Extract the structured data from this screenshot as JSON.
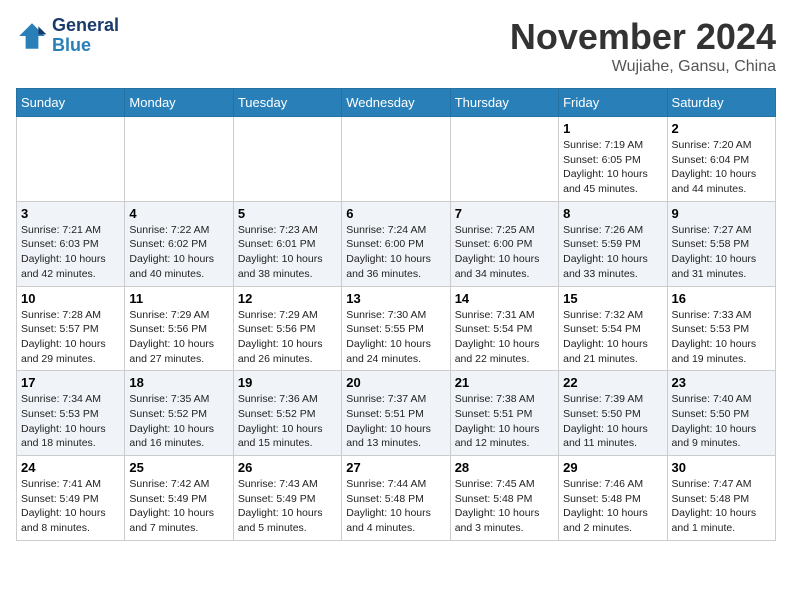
{
  "header": {
    "logo_line1": "General",
    "logo_line2": "Blue",
    "month": "November 2024",
    "location": "Wujiahe, Gansu, China"
  },
  "weekdays": [
    "Sunday",
    "Monday",
    "Tuesday",
    "Wednesday",
    "Thursday",
    "Friday",
    "Saturday"
  ],
  "weeks": [
    [
      {
        "day": "",
        "info": ""
      },
      {
        "day": "",
        "info": ""
      },
      {
        "day": "",
        "info": ""
      },
      {
        "day": "",
        "info": ""
      },
      {
        "day": "",
        "info": ""
      },
      {
        "day": "1",
        "info": "Sunrise: 7:19 AM\nSunset: 6:05 PM\nDaylight: 10 hours\nand 45 minutes."
      },
      {
        "day": "2",
        "info": "Sunrise: 7:20 AM\nSunset: 6:04 PM\nDaylight: 10 hours\nand 44 minutes."
      }
    ],
    [
      {
        "day": "3",
        "info": "Sunrise: 7:21 AM\nSunset: 6:03 PM\nDaylight: 10 hours\nand 42 minutes."
      },
      {
        "day": "4",
        "info": "Sunrise: 7:22 AM\nSunset: 6:02 PM\nDaylight: 10 hours\nand 40 minutes."
      },
      {
        "day": "5",
        "info": "Sunrise: 7:23 AM\nSunset: 6:01 PM\nDaylight: 10 hours\nand 38 minutes."
      },
      {
        "day": "6",
        "info": "Sunrise: 7:24 AM\nSunset: 6:00 PM\nDaylight: 10 hours\nand 36 minutes."
      },
      {
        "day": "7",
        "info": "Sunrise: 7:25 AM\nSunset: 6:00 PM\nDaylight: 10 hours\nand 34 minutes."
      },
      {
        "day": "8",
        "info": "Sunrise: 7:26 AM\nSunset: 5:59 PM\nDaylight: 10 hours\nand 33 minutes."
      },
      {
        "day": "9",
        "info": "Sunrise: 7:27 AM\nSunset: 5:58 PM\nDaylight: 10 hours\nand 31 minutes."
      }
    ],
    [
      {
        "day": "10",
        "info": "Sunrise: 7:28 AM\nSunset: 5:57 PM\nDaylight: 10 hours\nand 29 minutes."
      },
      {
        "day": "11",
        "info": "Sunrise: 7:29 AM\nSunset: 5:56 PM\nDaylight: 10 hours\nand 27 minutes."
      },
      {
        "day": "12",
        "info": "Sunrise: 7:29 AM\nSunset: 5:56 PM\nDaylight: 10 hours\nand 26 minutes."
      },
      {
        "day": "13",
        "info": "Sunrise: 7:30 AM\nSunset: 5:55 PM\nDaylight: 10 hours\nand 24 minutes."
      },
      {
        "day": "14",
        "info": "Sunrise: 7:31 AM\nSunset: 5:54 PM\nDaylight: 10 hours\nand 22 minutes."
      },
      {
        "day": "15",
        "info": "Sunrise: 7:32 AM\nSunset: 5:54 PM\nDaylight: 10 hours\nand 21 minutes."
      },
      {
        "day": "16",
        "info": "Sunrise: 7:33 AM\nSunset: 5:53 PM\nDaylight: 10 hours\nand 19 minutes."
      }
    ],
    [
      {
        "day": "17",
        "info": "Sunrise: 7:34 AM\nSunset: 5:53 PM\nDaylight: 10 hours\nand 18 minutes."
      },
      {
        "day": "18",
        "info": "Sunrise: 7:35 AM\nSunset: 5:52 PM\nDaylight: 10 hours\nand 16 minutes."
      },
      {
        "day": "19",
        "info": "Sunrise: 7:36 AM\nSunset: 5:52 PM\nDaylight: 10 hours\nand 15 minutes."
      },
      {
        "day": "20",
        "info": "Sunrise: 7:37 AM\nSunset: 5:51 PM\nDaylight: 10 hours\nand 13 minutes."
      },
      {
        "day": "21",
        "info": "Sunrise: 7:38 AM\nSunset: 5:51 PM\nDaylight: 10 hours\nand 12 minutes."
      },
      {
        "day": "22",
        "info": "Sunrise: 7:39 AM\nSunset: 5:50 PM\nDaylight: 10 hours\nand 11 minutes."
      },
      {
        "day": "23",
        "info": "Sunrise: 7:40 AM\nSunset: 5:50 PM\nDaylight: 10 hours\nand 9 minutes."
      }
    ],
    [
      {
        "day": "24",
        "info": "Sunrise: 7:41 AM\nSunset: 5:49 PM\nDaylight: 10 hours\nand 8 minutes."
      },
      {
        "day": "25",
        "info": "Sunrise: 7:42 AM\nSunset: 5:49 PM\nDaylight: 10 hours\nand 7 minutes."
      },
      {
        "day": "26",
        "info": "Sunrise: 7:43 AM\nSunset: 5:49 PM\nDaylight: 10 hours\nand 5 minutes."
      },
      {
        "day": "27",
        "info": "Sunrise: 7:44 AM\nSunset: 5:48 PM\nDaylight: 10 hours\nand 4 minutes."
      },
      {
        "day": "28",
        "info": "Sunrise: 7:45 AM\nSunset: 5:48 PM\nDaylight: 10 hours\nand 3 minutes."
      },
      {
        "day": "29",
        "info": "Sunrise: 7:46 AM\nSunset: 5:48 PM\nDaylight: 10 hours\nand 2 minutes."
      },
      {
        "day": "30",
        "info": "Sunrise: 7:47 AM\nSunset: 5:48 PM\nDaylight: 10 hours\nand 1 minute."
      }
    ]
  ]
}
